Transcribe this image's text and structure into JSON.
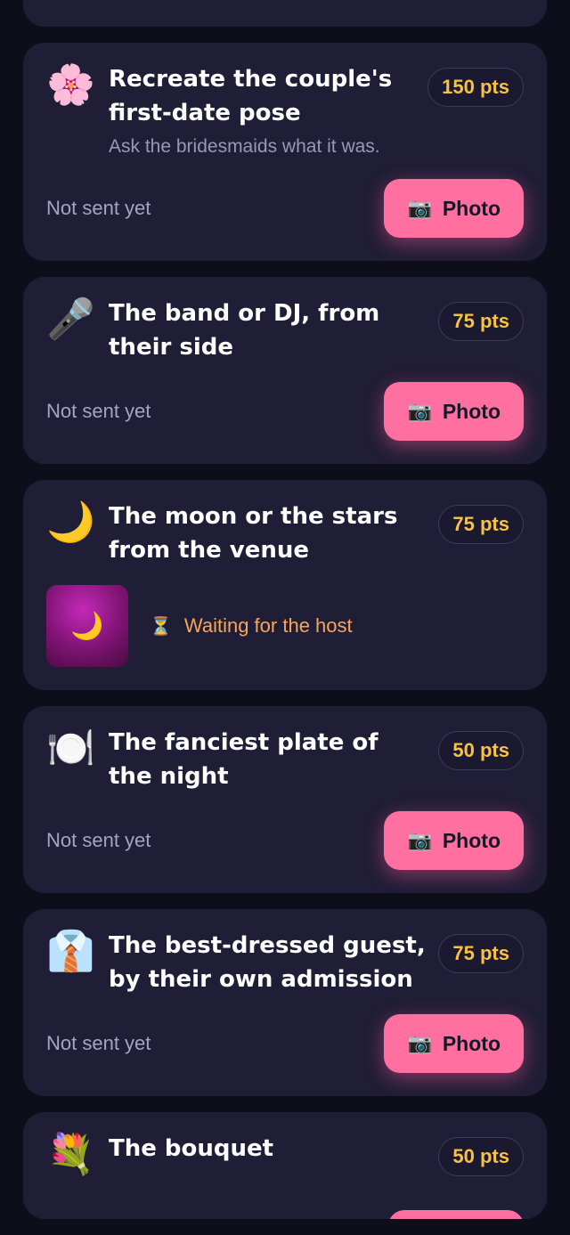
{
  "cards": [
    {
      "emoji": "🌸",
      "title": "Recreate the couple's first-date pose",
      "description": "Ask the bridesmaids what it was.",
      "points": "150 pts",
      "status": "Not sent yet",
      "button_label": "Photo"
    },
    {
      "emoji": "🎤",
      "title": "The band or DJ, from their side",
      "points": "75 pts",
      "status": "Not sent yet",
      "button_label": "Photo"
    },
    {
      "emoji": "🌙",
      "title": "The moon or the stars from the venue",
      "points": "75 pts",
      "thumbnail_emoji": "🌙",
      "waiting_text": "Waiting for the host"
    },
    {
      "emoji": "🍽️",
      "title": "The fanciest plate of the night",
      "points": "50 pts",
      "status": "Not sent yet",
      "button_label": "Photo"
    },
    {
      "emoji": "👔",
      "title": "The best-dressed guest, by their own admission",
      "points": "75 pts",
      "status": "Not sent yet",
      "button_label": "Photo"
    },
    {
      "emoji": "💐",
      "title": "The bouquet",
      "points": "50 pts"
    }
  ],
  "icons": {
    "camera": "📷",
    "hourglass": "⏳"
  },
  "colors": {
    "background": "#0e0d1a",
    "card": "#201d36",
    "accent_button": "#ff6fa0",
    "points_text": "#f6c145",
    "waiting_text": "#f5a65b"
  }
}
